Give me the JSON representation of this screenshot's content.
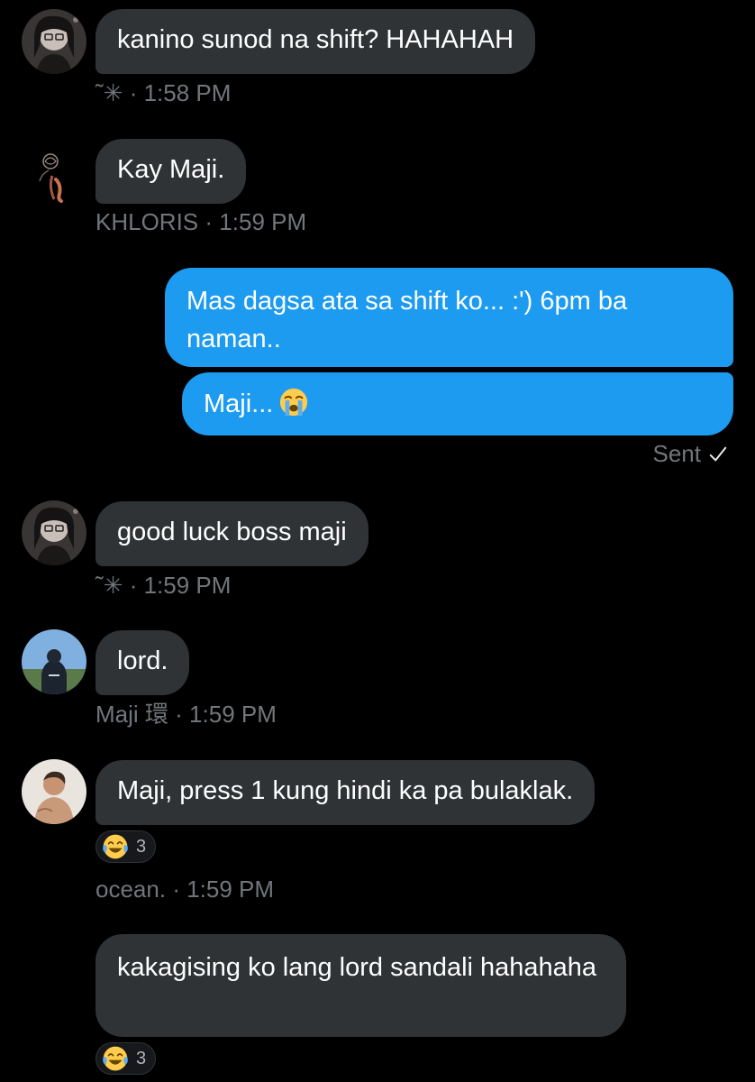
{
  "messages": [
    {
      "text": "kanino sunod na shift? HAHAHAH",
      "sender": "˜✳",
      "time": "1:58 PM"
    },
    {
      "text": "Kay Maji.",
      "sender": "KHLORIS",
      "time": "1:59 PM"
    },
    {
      "text": "Mas dagsa ata sa shift ko... :') 6pm ba naman.."
    },
    {
      "text": "Maji..."
    },
    {
      "text": "good luck boss maji",
      "sender": "˜✳",
      "time": "1:59 PM"
    },
    {
      "text": "lord.",
      "sender": "Maji 環",
      "time": "1:59 PM"
    },
    {
      "text": "Maji, press 1 kung hindi ka pa bulaklak.",
      "sender": "ocean.",
      "time": "1:59 PM",
      "reaction": {
        "icon": "face-with-tears-of-joy-icon",
        "count": "3"
      }
    },
    {
      "text": "kakagising ko lang lord sandali hahahaha",
      "reaction": {
        "icon": "face-with-tears-of-joy-icon",
        "count": "3"
      }
    }
  ],
  "sent_status": "Sent",
  "separator": "·",
  "icons": {
    "sent_check": "checkmark-icon",
    "crying_emoji": "loudly-crying-face-icon",
    "laugh_emoji": "face-with-tears-of-joy-icon"
  },
  "colors": {
    "background": "#000000",
    "incoming_bubble": "#2f3336",
    "outgoing_bubble": "#1d9bf0",
    "meta_text": "#71767b"
  }
}
